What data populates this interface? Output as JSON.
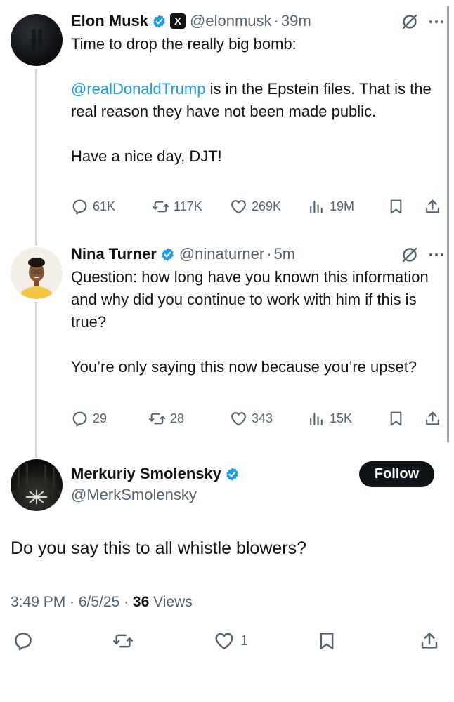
{
  "parent_tweet": {
    "name": "Elon Musk",
    "handle": "@elonmusk",
    "separator": "·",
    "time": "39m",
    "mention": "@realDonaldTrump",
    "text_before": "Time to drop the really big bomb:\n\n",
    "text_after": " is in the Epstein files. That is the real reason they have not been made public.\n\nHave a nice day, DJT!",
    "badge_text": "X",
    "stats": {
      "replies": "61K",
      "reposts": "117K",
      "likes": "269K",
      "views": "19M"
    }
  },
  "reply_tweet": {
    "name": "Nina Turner",
    "handle": "@ninaturner",
    "separator": "·",
    "time": "5m",
    "text": "Question: how long have you known this information and why did you continue to work with him if this is true?\n\nYou’re only saying this now because you’re upset?",
    "stats": {
      "replies": "29",
      "reposts": "28",
      "likes": "343",
      "views": "15K"
    }
  },
  "main_tweet": {
    "name": "Merkuriy Smolensky",
    "handle": "@MerkSmolensky",
    "follow_label": "Follow",
    "text": "Do you say this to all whistle blowers?",
    "timestamp": "3:49 PM · 6/5/25 · ",
    "views_count": "36",
    "views_label": " Views",
    "likes": "1"
  },
  "colors": {
    "accent": "#1d9bf0",
    "text": "#0f1419",
    "muted": "#536471",
    "thread_line": "#cfd9de"
  }
}
